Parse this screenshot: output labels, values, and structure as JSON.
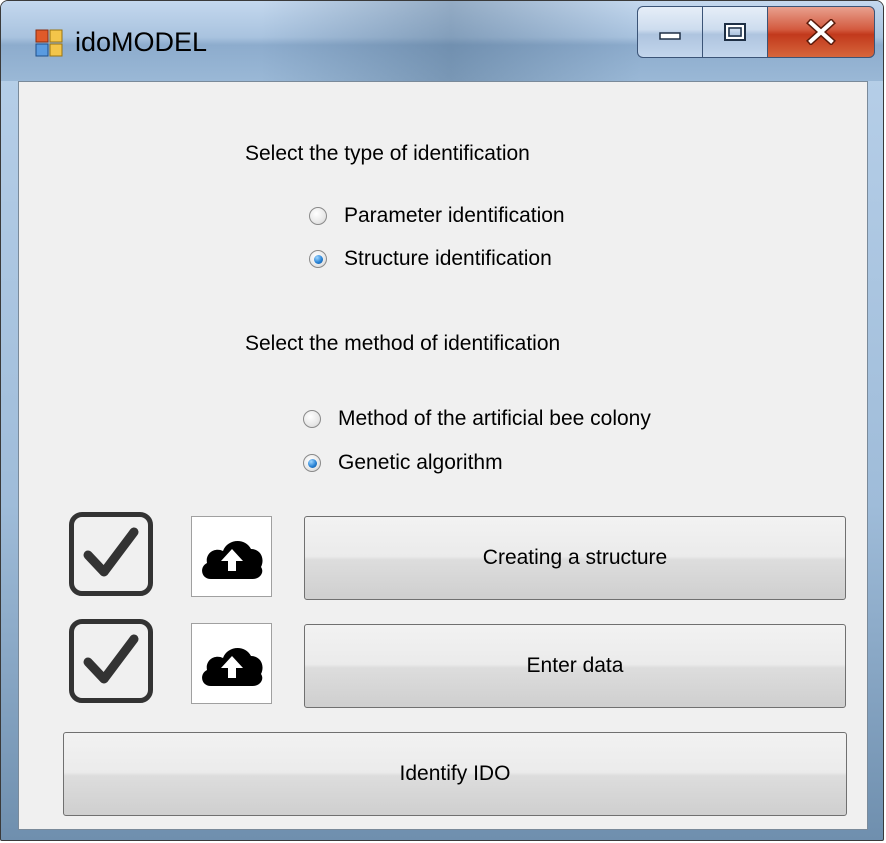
{
  "window": {
    "title": "idoMODEL"
  },
  "form": {
    "type_heading": "Select the type of identification",
    "type_options": [
      {
        "label": "Parameter identification",
        "checked": false
      },
      {
        "label": "Structure identification",
        "checked": true
      }
    ],
    "method_heading": "Select the method of identification",
    "method_options": [
      {
        "label": "Method of the artificial bee colony",
        "checked": false
      },
      {
        "label": "Genetic algorithm",
        "checked": true
      }
    ]
  },
  "rows": [
    {
      "checked": true,
      "button_label": "Creating a structure"
    },
    {
      "checked": true,
      "button_label": "Enter data"
    }
  ],
  "identify_button_label": "Identify IDO",
  "colors": {
    "radio_selected": "#2a84d6",
    "close_button": "#c2391c",
    "client_bg": "#f0f0f0"
  }
}
